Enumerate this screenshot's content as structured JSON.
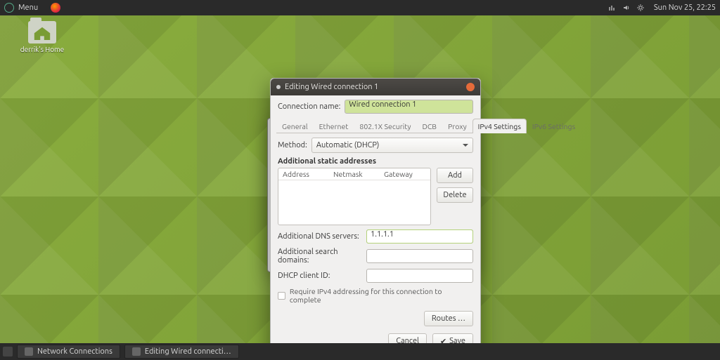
{
  "panel": {
    "menu_label": "Menu",
    "clock": "Sun Nov 25, 22:25"
  },
  "desktop_icon": {
    "label": "derrik's Home"
  },
  "taskbar": {
    "items": [
      "Network Connections",
      "Editing Wired connecti…"
    ]
  },
  "dialog": {
    "title": "Editing Wired connection 1",
    "conn_name_label": "Connection name:",
    "conn_name_value": "Wired connection 1",
    "tabs": [
      "General",
      "Ethernet",
      "802.1X Security",
      "DCB",
      "Proxy",
      "IPv4 Settings",
      "IPv6 Settings"
    ],
    "active_tab_index": 5,
    "method_label": "Method:",
    "method_value": "Automatic (DHCP)",
    "addresses_title": "Additional static addresses",
    "addr_cols": [
      "Address",
      "Netmask",
      "Gateway"
    ],
    "add_btn": "Add",
    "delete_btn": "Delete",
    "dns_label": "Additional DNS servers:",
    "dns_value": "1.1.1.1",
    "search_label": "Additional search domains:",
    "search_value": "",
    "dhcp_label": "DHCP client ID:",
    "dhcp_value": "",
    "require_label": "Require IPv4 addressing for this connection to complete",
    "routes_btn": "Routes …",
    "cancel_btn": "Cancel",
    "save_btn": "Save"
  }
}
